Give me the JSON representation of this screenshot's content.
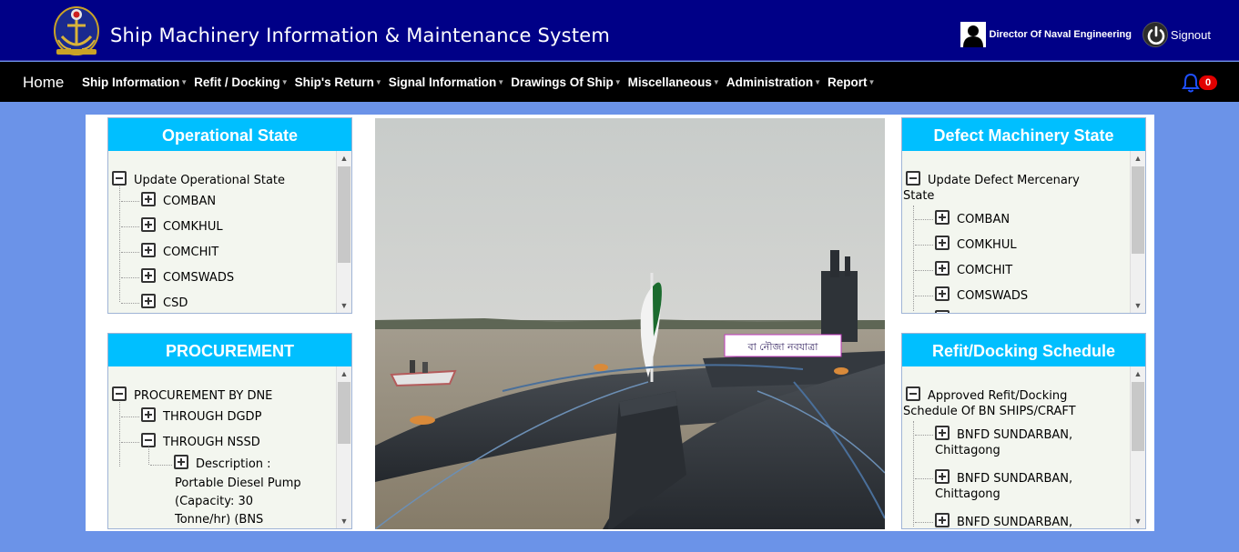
{
  "header": {
    "app_title": "Ship Machinery Information & Maintenance System",
    "user_name": "Director Of Naval Engineering",
    "signout_label": "Signout",
    "bg_color": "#000087"
  },
  "nav": {
    "home_label": "Home",
    "items": [
      {
        "label": "Ship Information",
        "has_dropdown": true
      },
      {
        "label": "Refit / Docking",
        "has_dropdown": true
      },
      {
        "label": "Ship's Return",
        "has_dropdown": true
      },
      {
        "label": "Signal Information",
        "has_dropdown": true
      },
      {
        "label": "Drawings Of Ship",
        "has_dropdown": true
      },
      {
        "label": "Miscellaneous",
        "has_dropdown": true
      },
      {
        "label": "Administration",
        "has_dropdown": true
      },
      {
        "label": "Report",
        "has_dropdown": true
      }
    ],
    "notification_count": "0"
  },
  "panels": {
    "operational_state": {
      "title": "Operational State",
      "root": "Update Operational State",
      "children": [
        "COMBAN",
        "COMKHUL",
        "COMCHIT",
        "COMSWADS",
        "CSD"
      ]
    },
    "procurement": {
      "title": "PROCUREMENT",
      "root": "PROCUREMENT BY DNE",
      "children": [
        "THROUGH DGDP",
        "THROUGH NSSD"
      ],
      "nssd_child_lines": [
        "Description :",
        "Portable Diesel Pump",
        "(Capacity: 30",
        "Tonne/hr) (BNS"
      ]
    },
    "defect_machinery": {
      "title": "Defect Machinery State",
      "root_line1": "Update Defect Mercenary",
      "root_line2": "State",
      "children": [
        "COMBAN",
        "COMKHUL",
        "COMCHIT",
        "COMSWADS"
      ]
    },
    "refit_docking": {
      "title": "Refit/Docking Schedule",
      "root_line1": "Approved Refit/Docking",
      "root_line2": "Schedule Of BN SHIPS/CRAFT",
      "children": [
        {
          "line1": "BNFD SUNDARBAN,",
          "line2": "Chittagong"
        },
        {
          "line1": "BNFD SUNDARBAN,",
          "line2": "Chittagong"
        },
        {
          "line1": "BNFD SUNDARBAN,",
          "line2": ""
        }
      ]
    }
  },
  "photo": {
    "banner_text": "বা নৌজা নবযাত্রা"
  },
  "colors": {
    "page_bg": "#6b93e8",
    "panel_header": "#00bfff",
    "panel_body": "#f3f6ef",
    "nav_bg": "#000000",
    "badge": "#e10000"
  }
}
